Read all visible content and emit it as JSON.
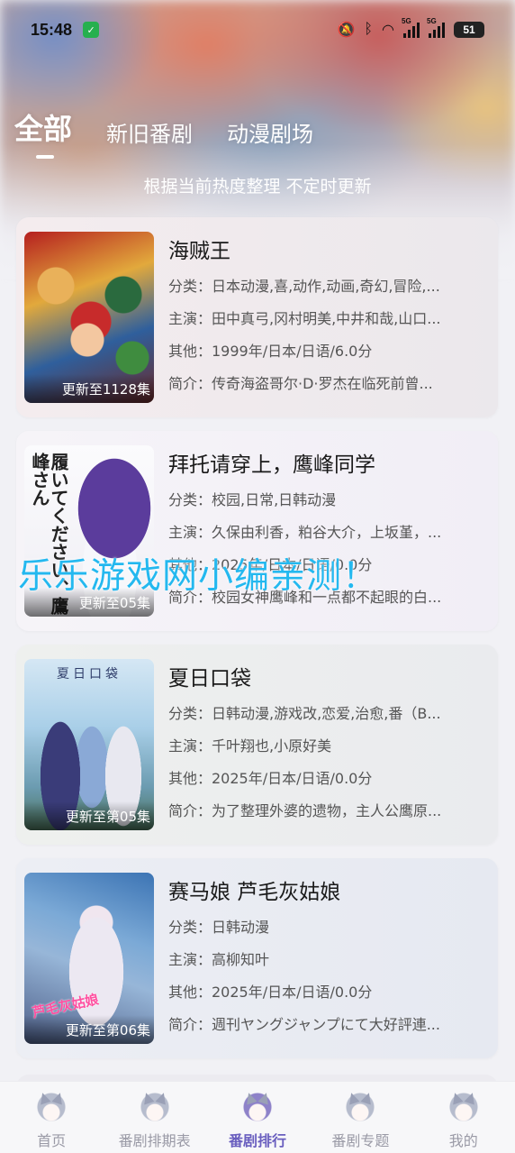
{
  "status_bar": {
    "time": "15:48",
    "shield_icon": "shield-check-icon",
    "network1": "5G",
    "network2": "5G",
    "battery": "51"
  },
  "tabs": [
    {
      "label": "全部",
      "active": true
    },
    {
      "label": "新旧番剧",
      "active": false
    },
    {
      "label": "动漫剧场",
      "active": false
    }
  ],
  "subtitle": "根据当前热度整理 不定时更新",
  "items": [
    {
      "title": "海贼王",
      "episode": "更新至1128集",
      "category": "分类：日本动漫,喜,动作,动画,奇幻,冒险,...",
      "cast": "主演：田中真弓,冈村明美,中井和哉,山口...",
      "other": "其他：1999年/日本/日语/6.0分",
      "intro": "简介：传奇海盗哥尔·D·罗杰在临死前曾..."
    },
    {
      "title": "拜托请穿上，鹰峰同学",
      "episode": "更新至05集",
      "poster_text": "履いてください、鷹峰さん",
      "category": "分类：校园,日常,日韩动漫",
      "cast": "主演：久保由利香，粕谷大介，上坂堇，...",
      "other": "其他：2025年/日本/日语/0.0分",
      "intro": "简介：校园女神鹰峰和一点都不起眼的白..."
    },
    {
      "title": "夏日口袋",
      "episode": "更新至第05集",
      "poster_text": "夏日口袋",
      "category": "分类：日韩动漫,游戏改,恋爱,治愈,番（B...",
      "cast": "主演：千叶翔也,小原好美",
      "other": "其他：2025年/日本/日语/0.0分",
      "intro": "简介：为了整理外婆的遗物，主人公鹰原..."
    },
    {
      "title": "赛马娘 芦毛灰姑娘",
      "episode": "更新至第06集",
      "poster_text": "芦毛灰姑娘",
      "category": "分类：日韩动漫",
      "cast": "主演：高柳知叶",
      "other": "其他：2025年/日本/日语/0.0分",
      "intro": "简介：週刊ヤングジャンプにて大好評連..."
    }
  ],
  "watermark": "乐乐游戏网小编亲测！",
  "bottom_nav": [
    {
      "label": "首页",
      "icon": "catgirl-avatar-icon",
      "active": false
    },
    {
      "label": "番剧排期表",
      "icon": "catgirl-avatar-icon",
      "active": false
    },
    {
      "label": "番剧排行",
      "icon": "catgirl-avatar-icon",
      "active": true
    },
    {
      "label": "番剧专题",
      "icon": "catgirl-avatar-icon",
      "active": false
    },
    {
      "label": "我的",
      "icon": "catgirl-avatar-icon",
      "active": false
    }
  ]
}
